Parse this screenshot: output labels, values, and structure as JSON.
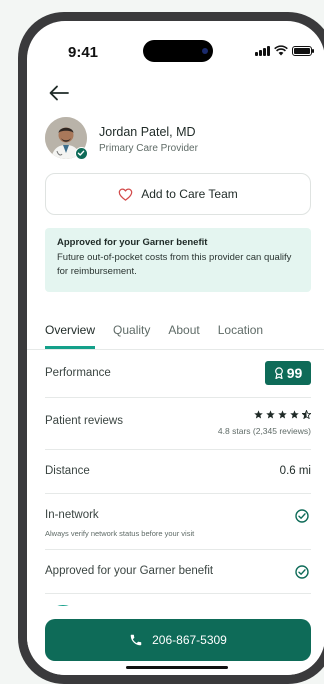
{
  "status_bar": {
    "time": "9:41"
  },
  "provider": {
    "name": "Jordan Patel, MD",
    "role": "Primary Care Provider"
  },
  "care_team_button": {
    "label": "Add to Care Team"
  },
  "benefit_banner": {
    "title": "Approved for your Garner benefit",
    "text": "Future out-of-pocket costs from this provider can qualify for reimbursement."
  },
  "tabs": [
    {
      "label": "Overview",
      "active": true
    },
    {
      "label": "Quality",
      "active": false
    },
    {
      "label": "About",
      "active": false
    },
    {
      "label": "Location",
      "active": false
    }
  ],
  "rows": {
    "performance": {
      "label": "Performance",
      "score": "99"
    },
    "reviews": {
      "label": "Patient reviews",
      "rating": 4.8,
      "meta": "4.8 stars (2,345 reviews)"
    },
    "distance": {
      "label": "Distance",
      "value": "0.6 mi"
    },
    "in_network": {
      "label": "In-network",
      "note": "Always verify network status before your visit"
    },
    "approved": {
      "label": "Approved for your Garner benefit"
    }
  },
  "call_button": {
    "label": "206-867-5309"
  },
  "colors": {
    "brand": "#0e6b58",
    "accent": "#14a08a",
    "banner_bg": "#e4f5f0"
  },
  "icons": {
    "back": "arrow-left-icon",
    "heart": "heart-outline-icon",
    "award": "award-ribbon-icon",
    "check": "check-circle-icon",
    "phone": "phone-icon"
  }
}
